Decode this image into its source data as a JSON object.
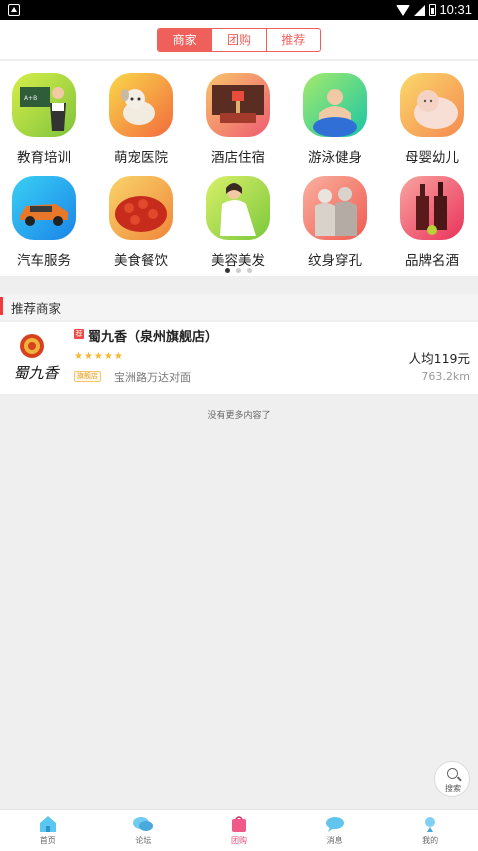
{
  "status_bar": {
    "time": "10:31"
  },
  "segments": [
    {
      "label": "商家",
      "active": true
    },
    {
      "label": "团购",
      "active": false
    },
    {
      "label": "推荐",
      "active": false
    }
  ],
  "categories": [
    {
      "label": "教育培训",
      "icon": "education-icon",
      "color": "#9acd32"
    },
    {
      "label": "萌宠医院",
      "icon": "pet-hospital-icon",
      "color": "#f59a3a"
    },
    {
      "label": "酒店住宿",
      "icon": "hotel-icon",
      "color": "#f5a25a"
    },
    {
      "label": "游泳健身",
      "icon": "swimming-fitness-icon",
      "color": "#44cf9e"
    },
    {
      "label": "母婴幼儿",
      "icon": "mother-baby-icon",
      "color": "#f6b04a"
    },
    {
      "label": "汽车服务",
      "icon": "car-service-icon",
      "color": "#39b7f0"
    },
    {
      "label": "美食餐饮",
      "icon": "food-icon",
      "color": "#f6b23a"
    },
    {
      "label": "美容美发",
      "icon": "beauty-salon-icon",
      "color": "#a7d93a"
    },
    {
      "label": "纹身穿孔",
      "icon": "tattoo-piercing-icon",
      "color": "#f38a6e"
    },
    {
      "label": "品牌名酒",
      "icon": "wine-icon",
      "color": "#f05c73"
    }
  ],
  "pager": {
    "pages": 3,
    "current": 1
  },
  "section": {
    "title": "推荐商家"
  },
  "shop": {
    "rec_tag": "荐",
    "name": "蜀九香（泉州旗舰店）",
    "rating": 5,
    "stars": "★★★★★",
    "avg_price": "人均119元",
    "badge": "旗舰店",
    "address": "宝洲路万达对面",
    "distance": "763.2km",
    "logo_text": "蜀九香"
  },
  "no_more": "没有更多内容了",
  "search_fab": {
    "label": "搜索"
  },
  "tabs": [
    {
      "label": "首页",
      "icon": "home-icon",
      "active": false
    },
    {
      "label": "论坛",
      "icon": "forum-icon",
      "active": false
    },
    {
      "label": "团购",
      "icon": "group-buy-icon",
      "active": true
    },
    {
      "label": "消息",
      "icon": "message-icon",
      "active": false
    },
    {
      "label": "我的",
      "icon": "profile-icon",
      "active": false
    }
  ]
}
